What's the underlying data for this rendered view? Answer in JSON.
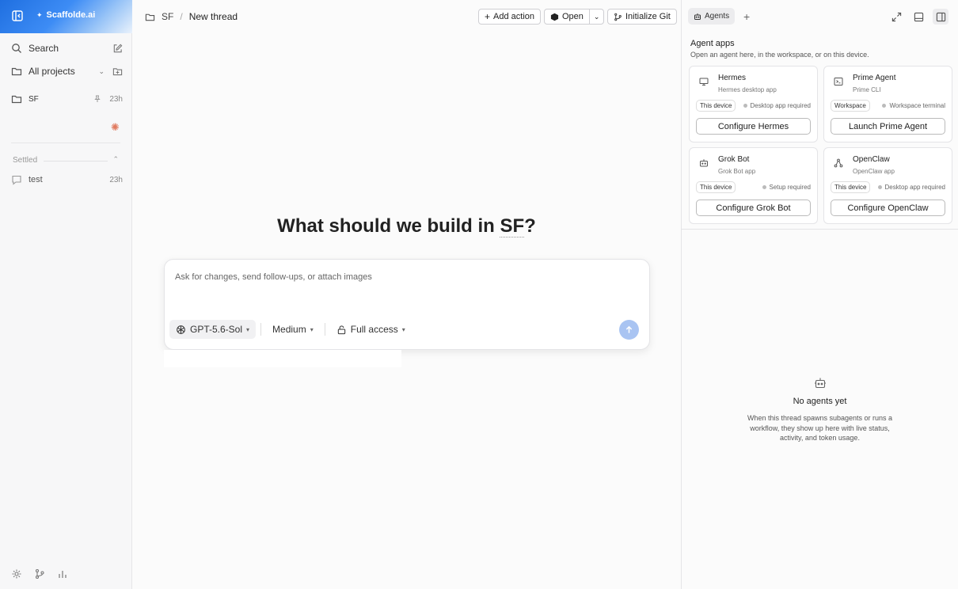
{
  "sidebar": {
    "brand": "Scaffolde.ai",
    "search_label": "Search",
    "projects_label": "All projects",
    "projects": [
      {
        "name": "SF",
        "age": "23h"
      }
    ],
    "section_label": "Settled",
    "threads": [
      {
        "name": "test",
        "age": "23h"
      }
    ]
  },
  "main": {
    "breadcrumb": {
      "project": "SF",
      "separator": "/",
      "current": "New thread"
    },
    "actions": {
      "add_action": "Add action",
      "open": "Open",
      "init_git": "Initialize Git"
    },
    "hero": {
      "prefix": "What should we build in ",
      "project": "SF",
      "suffix": "?"
    },
    "composer": {
      "placeholder": "Ask for changes, send follow-ups, or attach images",
      "model": "GPT-5.6-Sol",
      "effort": "Medium",
      "access": "Full access"
    }
  },
  "panel": {
    "tab_label": "Agents",
    "title": "Agent apps",
    "subtitle": "Open an agent here, in the workspace, or on this device.",
    "agents": [
      {
        "name": "Hermes",
        "desc": "Hermes desktop app",
        "badge": "This device",
        "status": "Desktop app required",
        "button": "Configure Hermes",
        "icon": "monitor-icon"
      },
      {
        "name": "Prime Agent",
        "desc": "Prime CLI",
        "badge": "Workspace",
        "status": "Workspace terminal",
        "button": "Launch Prime Agent",
        "icon": "terminal-icon"
      },
      {
        "name": "Grok Bot",
        "desc": "Grok Bot app",
        "badge": "This device",
        "status": "Setup required",
        "button": "Configure Grok Bot",
        "icon": "bot-icon"
      },
      {
        "name": "OpenClaw",
        "desc": "OpenClaw app",
        "badge": "This device",
        "status": "Desktop app required",
        "button": "Configure OpenClaw",
        "icon": "network-icon"
      }
    ],
    "empty": {
      "title": "No agents yet",
      "desc": "When this thread spawns subagents or runs a workflow, they show up here with live status, activity, and token usage."
    }
  },
  "colors": {
    "accent": "#3d8cf5",
    "send": "#a9c4f2",
    "spark": "#e07a5f"
  }
}
